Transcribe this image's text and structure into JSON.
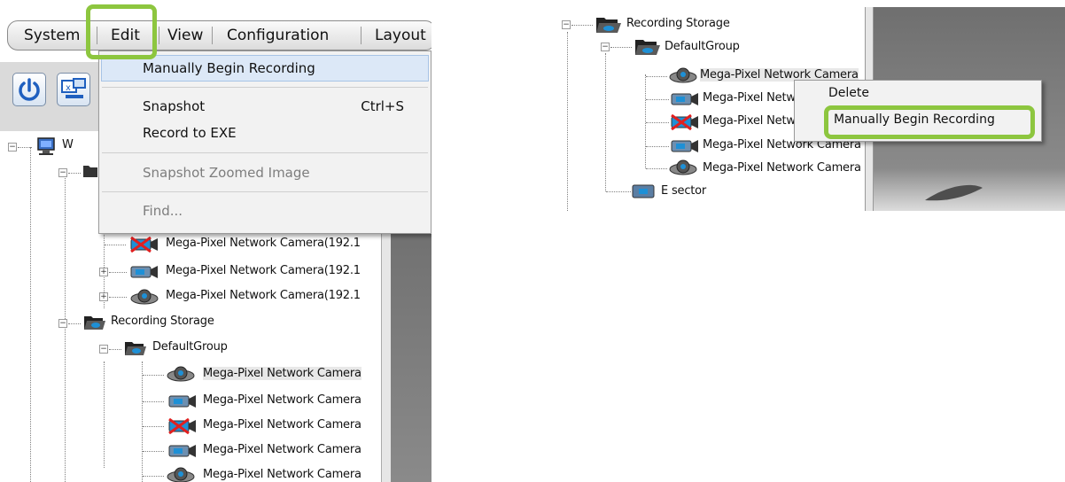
{
  "menubar": {
    "items": [
      "System",
      "Edit",
      "View",
      "Configuration",
      "Layout"
    ]
  },
  "edit_menu": {
    "items": [
      {
        "label": "Manually Begin Recording",
        "shortcut": ""
      },
      {
        "label": "Snapshot",
        "shortcut": "Ctrl+S"
      },
      {
        "label": "Record to EXE",
        "shortcut": ""
      },
      {
        "label": "Snapshot Zoomed Image",
        "shortcut": ""
      },
      {
        "label": "Find...",
        "shortcut": ""
      }
    ]
  },
  "left_tree": {
    "root_label": "W",
    "camera_ip_rows": [
      "Mega-Pixel Network Camera(192.1",
      "Mega-Pixel Network Camera(192.1",
      "Mega-Pixel Network Camera(192.1"
    ],
    "recording_storage": "Recording Storage",
    "default_group": "DefaultGroup",
    "group_cameras": [
      "Mega-Pixel Network Camera",
      "Mega-Pixel Network Camera",
      "Mega-Pixel Network Camera",
      "Mega-Pixel Network Camera",
      "Mega-Pixel Network Camera"
    ]
  },
  "right_tree": {
    "recording_storage": "Recording Storage",
    "default_group": "DefaultGroup",
    "cameras": [
      "Mega-Pixel Network Camera",
      "Mega-Pixel Netw",
      "Mega-Pixel Netw",
      "Mega-Pixel Network Camera",
      "Mega-Pixel Network Camera"
    ],
    "e_sector": "E sector"
  },
  "context_menu": {
    "items": [
      "Delete",
      "Manually Begin Recording"
    ]
  },
  "colors": {
    "highlight": "#8dc63f",
    "camera_disabled": "#e02020"
  }
}
